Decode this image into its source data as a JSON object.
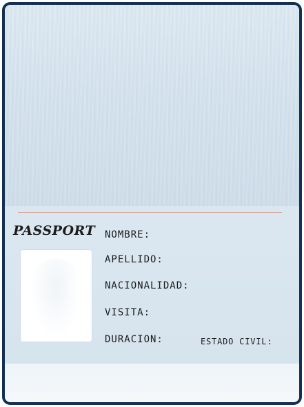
{
  "passport": {
    "title": "PASSPORT",
    "fields": {
      "nombre": "NOMBRE:",
      "apellido": "APELLIDO:",
      "nacionalidad": "NACIONALIDAD:",
      "visita": "VISITA:",
      "duracion": "DURACION:",
      "estado_civil": "ESTADO CIVIL:"
    }
  },
  "colors": {
    "frame": "#14304f",
    "background": "#dbe7f0",
    "divider": "#d9a99c",
    "photo": "#ffffff"
  }
}
